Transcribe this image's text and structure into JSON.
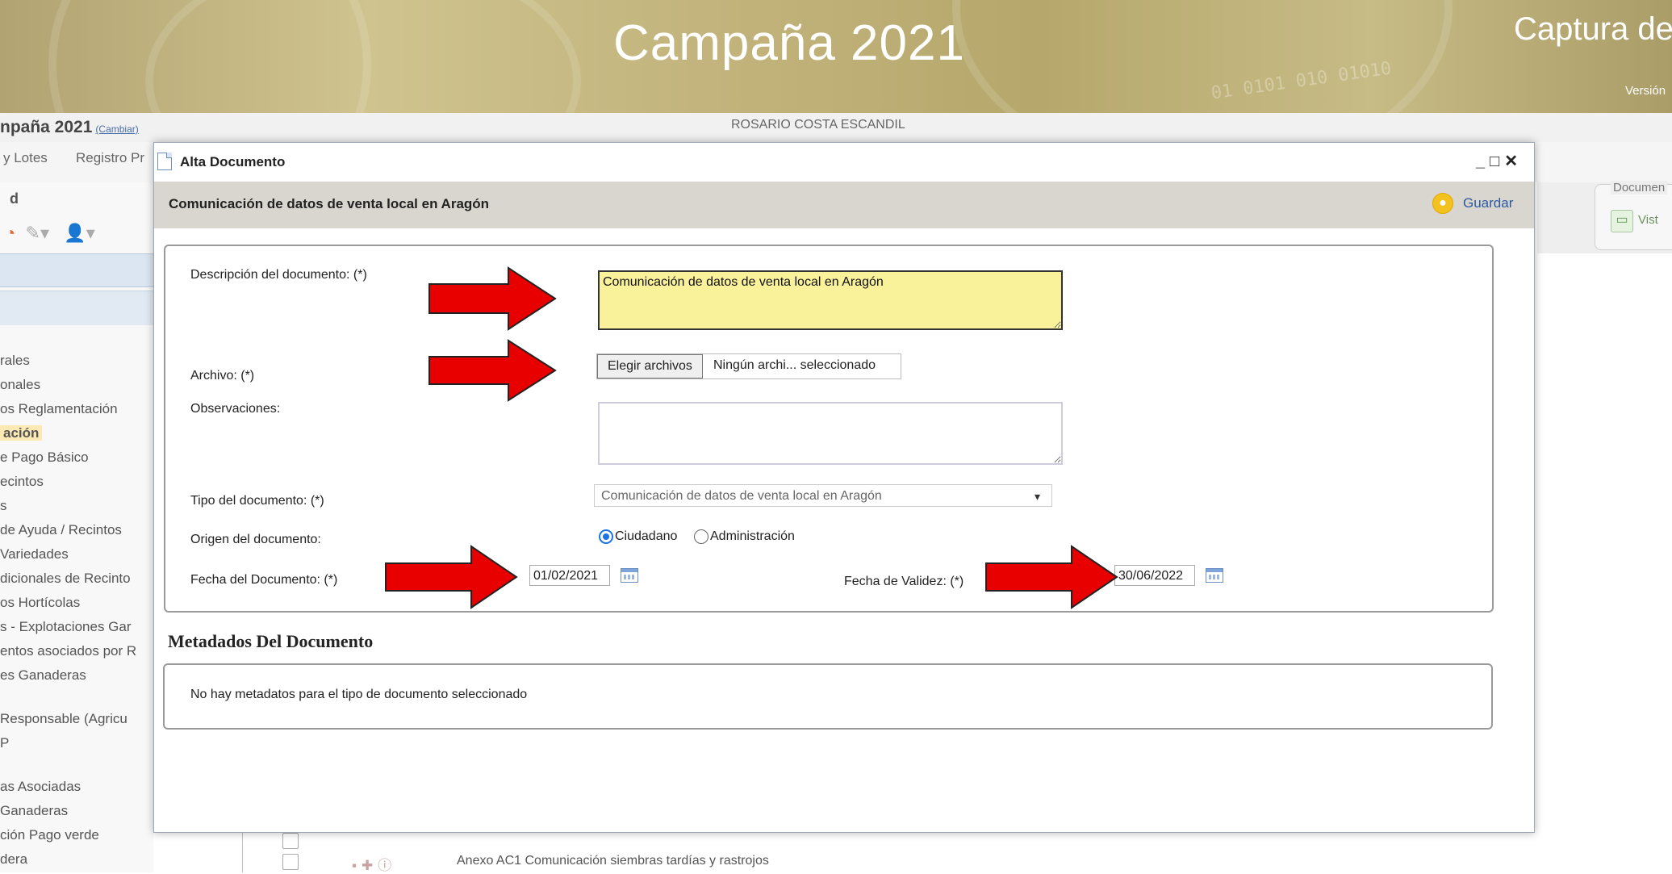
{
  "banner": {
    "title": "Campaña 2021",
    "right_title": "Captura de",
    "version_label": "Versión",
    "binary_text": "01 0101 010 01010"
  },
  "user": {
    "name": "ROSARIO COSTA ESCANDIL"
  },
  "campaign": {
    "label": "npaña 2021",
    "change_link": "(Cambiar)"
  },
  "menu": {
    "items": [
      "y Lotes",
      "Registro Pr"
    ]
  },
  "sidebar": {
    "header_letter": "d",
    "items": [
      {
        "label": "rales",
        "active": false
      },
      {
        "label": "onales",
        "active": false
      },
      {
        "label": "os Reglamentación",
        "active": false
      },
      {
        "label": "ación",
        "active": true
      },
      {
        "label": "e Pago Básico",
        "active": false
      },
      {
        "label": "ecintos",
        "active": false
      },
      {
        "label": "s",
        "active": false
      },
      {
        "label": "de Ayuda / Recintos",
        "active": false
      },
      {
        "label": "Variedades",
        "active": false
      },
      {
        "label": "dicionales de Recinto",
        "active": false
      },
      {
        "label": "os Hortícolas",
        "active": false
      },
      {
        "label": "s - Explotaciones Gar",
        "active": false
      },
      {
        "label": "entos asociados por R",
        "active": false
      },
      {
        "label": "es Ganaderas",
        "active": false
      }
    ],
    "items2": [
      {
        "label": "Responsable (Agricu"
      },
      {
        "label": "P"
      }
    ],
    "items3": [
      {
        "label": "as Asociadas"
      },
      {
        "label": "Ganaderas"
      },
      {
        "label": "ción Pago verde"
      },
      {
        "label": "dera"
      }
    ]
  },
  "right_panel": {
    "title": "Documen",
    "button_label": "Vist"
  },
  "background_row": {
    "text": "Anexo AC1 Comunicación siembras tardías y rastrojos"
  },
  "modal": {
    "title": "Alta Documento",
    "controls": "_ □ ✕",
    "section_title": "Comunicación de datos de venta local en Aragón",
    "save_label": "Guardar",
    "form": {
      "description_label": "Descripción del documento: (*)",
      "description_value": "Comunicación de datos de venta local en Aragón",
      "file_label": "Archivo: (*)",
      "file_button": "Elegir archivos",
      "file_status": "Ningún archi... seleccionado",
      "observations_label": "Observaciones:",
      "observations_value": "",
      "type_label": "Tipo del documento: (*)",
      "type_value": "Comunicación de datos de venta local en Aragón",
      "origin_label": "Origen del documento:",
      "origin_options": [
        "Ciudadano",
        "Administración"
      ],
      "origin_selected": "Ciudadano",
      "doc_date_label": "Fecha del Documento: (*)",
      "doc_date_value": "01/02/2021",
      "validity_label": "Fecha de Validez: (*)",
      "validity_value": "30/06/2022"
    },
    "metadata": {
      "title": "Metadados Del Documento",
      "empty_text": "No hay metadatos para el tipo de documento seleccionado"
    }
  },
  "colors": {
    "arrow": "#e80000",
    "description_bg": "#faf19b",
    "header_bg": "#d9d6cf",
    "link": "#2c5aa0"
  }
}
